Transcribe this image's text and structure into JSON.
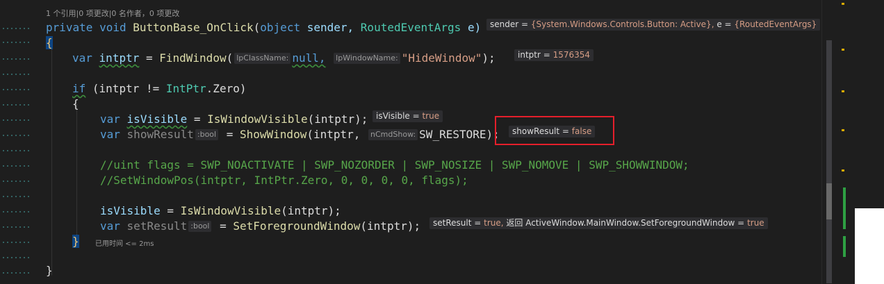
{
  "codelens": "1 个引用|0 项更改|0 名作者，0 项更改",
  "code": {
    "sig_private": "private",
    "sig_void": "void",
    "sig_name": "ButtonBase_OnClick",
    "sig_p1_type": "object",
    "sig_p1_name": "sender,",
    "sig_p2_type": "RoutedEventArgs",
    "sig_p2_name": "e)",
    "open_brace": "{",
    "close_brace": "}",
    "line_intptr_var": "var",
    "line_intptr_name": "intptr",
    "line_intptr_call": "FindWindow",
    "hint_lpClassName": "lpClassName:",
    "line_null": "null,",
    "hint_lpWindowName": "lpWindowName:",
    "line_hide": "\"HideWindow\"",
    "line_if": "if",
    "line_if_cond": "(intptr != ",
    "line_intptr_type": "IntPtr",
    "line_zero": ".Zero)",
    "line_isvisible_name": "isVisible",
    "line_iwv": "IsWindowVisible",
    "line_iwv_args": "(intptr);",
    "line_showresult_name": "showResult",
    "hint_bool": ":bool",
    "line_showwindow": "ShowWindow",
    "line_sw_args": "(intptr,",
    "hint_ncmd": "nCmdShow:",
    "line_sw_restore": "SW_RESTORE);",
    "comment1": "//uint flags = SWP_NOACTIVATE | SWP_NOZORDER | SWP_NOSIZE | SWP_NOMOVE | SWP_SHOWWINDOW;",
    "comment2": "//SetWindowPos(intptr, IntPtr.Zero, 0, 0, 0, 0, flags);",
    "line_isvisible_assign": "isVisible",
    "line_setresult_name": "setResult",
    "line_sfw": "SetForegroundWindow",
    "eq": " = "
  },
  "datatips": {
    "sender_label": "sender = ",
    "sender_value": "{System.Windows.Controls.Button: Active},",
    "e_label": "e = ",
    "e_value": "{RoutedEventArgs}",
    "intptr_label": "intptr = ",
    "intptr_value": "1576354",
    "isvisible_label": "isVisible = ",
    "isvisible_value": "true",
    "showresult_label": "showResult = ",
    "showresult_value": "false",
    "setresult_label": "setResult = ",
    "setresult_value": "true,",
    "return_label": "返回 ActiveWindow.MainWindow.SetForegroundWindow = ",
    "return_value": "true"
  },
  "elapsed": "已用时间 <= 2ms",
  "colors": {
    "highlight_box": "#e51f2b",
    "keyword": "#569cd6",
    "type": "#4ec9b0",
    "method": "#dcdcaa",
    "string": "#d69d85",
    "comment": "#57a64a"
  }
}
